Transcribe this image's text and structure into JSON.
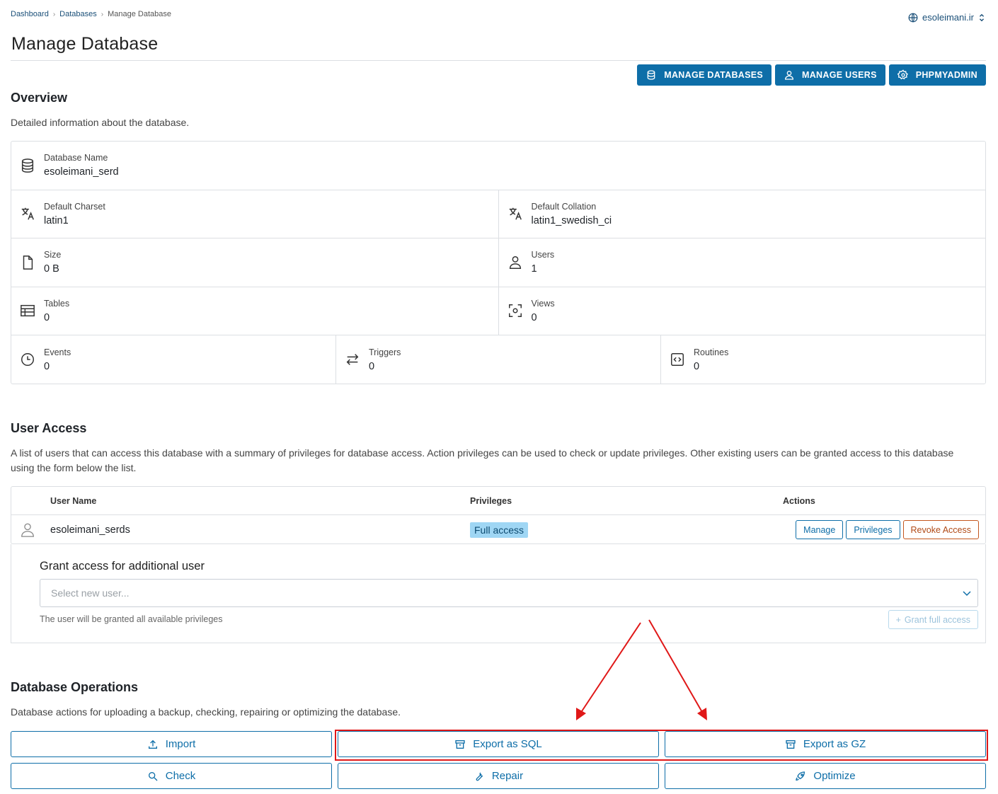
{
  "breadcrumb": {
    "item1": "Dashboard",
    "item2": "Databases",
    "item3": "Manage Database"
  },
  "domain_selector": {
    "value": "esoleimani.ir"
  },
  "page_title": "Manage Database",
  "top_actions": {
    "manage_databases": "MANAGE DATABASES",
    "manage_users": "MANAGE USERS",
    "phpmyadmin": "PHPMYADMIN"
  },
  "overview": {
    "title": "Overview",
    "description": "Detailed information about the database.",
    "fields": {
      "database_name": {
        "label": "Database Name",
        "value": "esoleimani_serd",
        "icon": "database-icon"
      },
      "default_charset": {
        "label": "Default Charset",
        "value": "latin1",
        "icon": "translate-icon"
      },
      "default_collation": {
        "label": "Default Collation",
        "value": "latin1_swedish_ci",
        "icon": "translate-icon"
      },
      "size": {
        "label": "Size",
        "value": "0 B",
        "icon": "file-icon"
      },
      "users": {
        "label": "Users",
        "value": "1",
        "icon": "user-icon"
      },
      "tables": {
        "label": "Tables",
        "value": "0",
        "icon": "table-icon"
      },
      "views": {
        "label": "Views",
        "value": "0",
        "icon": "view-icon"
      },
      "events": {
        "label": "Events",
        "value": "0",
        "icon": "clock-icon"
      },
      "triggers": {
        "label": "Triggers",
        "value": "0",
        "icon": "arrows-icon"
      },
      "routines": {
        "label": "Routines",
        "value": "0",
        "icon": "code-icon"
      }
    }
  },
  "user_access": {
    "title": "User Access",
    "description": "A list of users that can access this database with a summary of privileges for database access. Action privileges can be used to check or update privileges. Other existing users can be granted access to this database using the form below the list.",
    "columns": {
      "user_name": "User Name",
      "privileges": "Privileges",
      "actions": "Actions"
    },
    "rows": [
      {
        "user": "esoleimani_serds",
        "privilege": "Full access",
        "manage": "Manage",
        "privileges_btn": "Privileges",
        "revoke": "Revoke Access"
      }
    ],
    "grant": {
      "title": "Grant access for additional user",
      "placeholder": "Select new user...",
      "note": "The user will be granted all available privileges",
      "button": "Grant full access"
    }
  },
  "operations": {
    "title": "Database Operations",
    "description": "Database actions for uploading a backup, checking, repairing or optimizing the database.",
    "buttons": {
      "import": "Import",
      "export_sql": "Export as SQL",
      "export_gz": "Export as GZ",
      "check": "Check",
      "repair": "Repair",
      "optimize": "Optimize"
    }
  },
  "colors": {
    "primary": "#0e6ea8",
    "badge": "#9fd6f4",
    "danger": "#c4561e",
    "annotation": "#e01818"
  }
}
